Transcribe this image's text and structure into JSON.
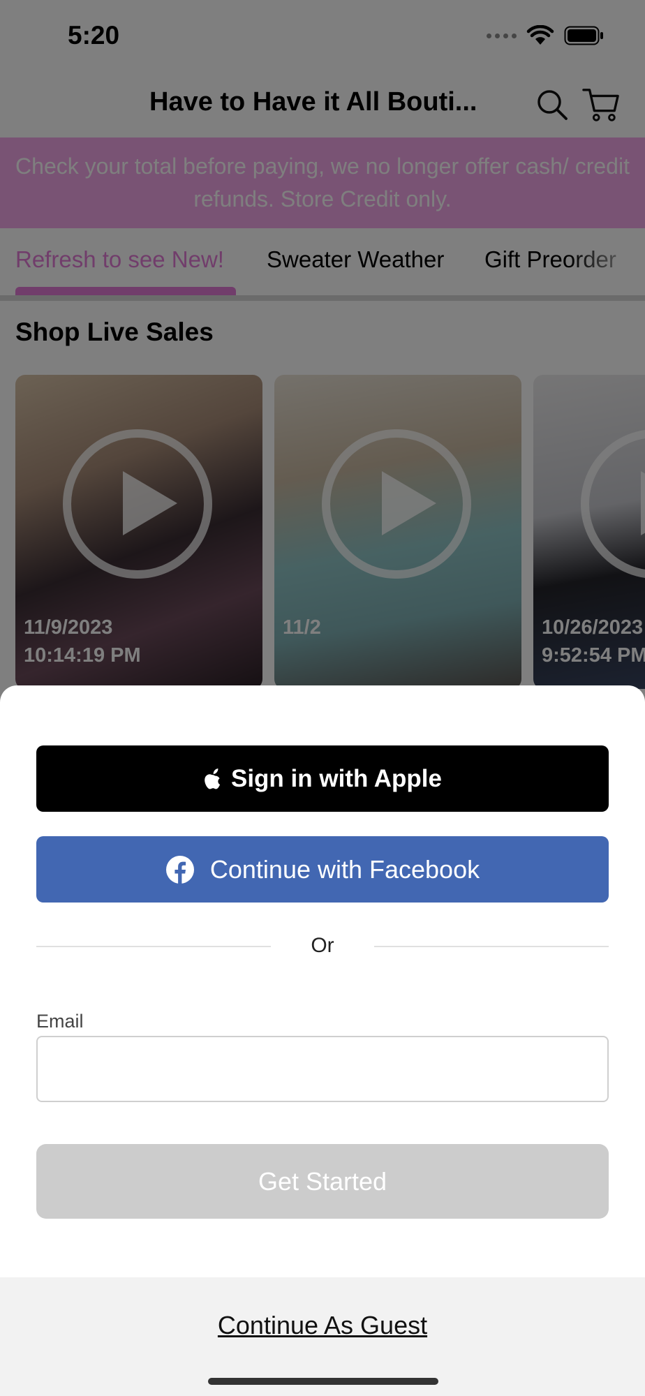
{
  "status_bar": {
    "time": "5:20",
    "icons": [
      "signal-dots-icon",
      "wifi-icon",
      "battery-icon"
    ]
  },
  "header": {
    "title": "Have to Have it All Bouti...",
    "search_icon": "search-icon",
    "cart_icon": "cart-icon"
  },
  "banner": {
    "text": "Check your total before paying, we no longer offer cash/ credit refunds. Store Credit only.",
    "color": "#f3a6e8"
  },
  "tabs": [
    {
      "label": "Refresh to see New!",
      "active": true
    },
    {
      "label": "Sweater Weather",
      "active": false
    },
    {
      "label": "Gift Preorder",
      "active": false
    }
  ],
  "accent_color": "#e27ad6",
  "live_sales": {
    "title": "Shop Live Sales",
    "videos": [
      {
        "date": "11/9/2023",
        "time": "10:14:19 PM"
      },
      {
        "date": "11/2",
        "time": ""
      },
      {
        "date": "10/26/2023",
        "time": "9:52:54 PM"
      }
    ]
  },
  "login": {
    "apple_label": "Sign in with Apple",
    "facebook_label": "Continue with Facebook",
    "facebook_color": "#4267b2",
    "or_label": "Or",
    "email_label": "Email",
    "email_value": "",
    "get_started_label": "Get Started",
    "guest_label": "Continue As Guest"
  }
}
